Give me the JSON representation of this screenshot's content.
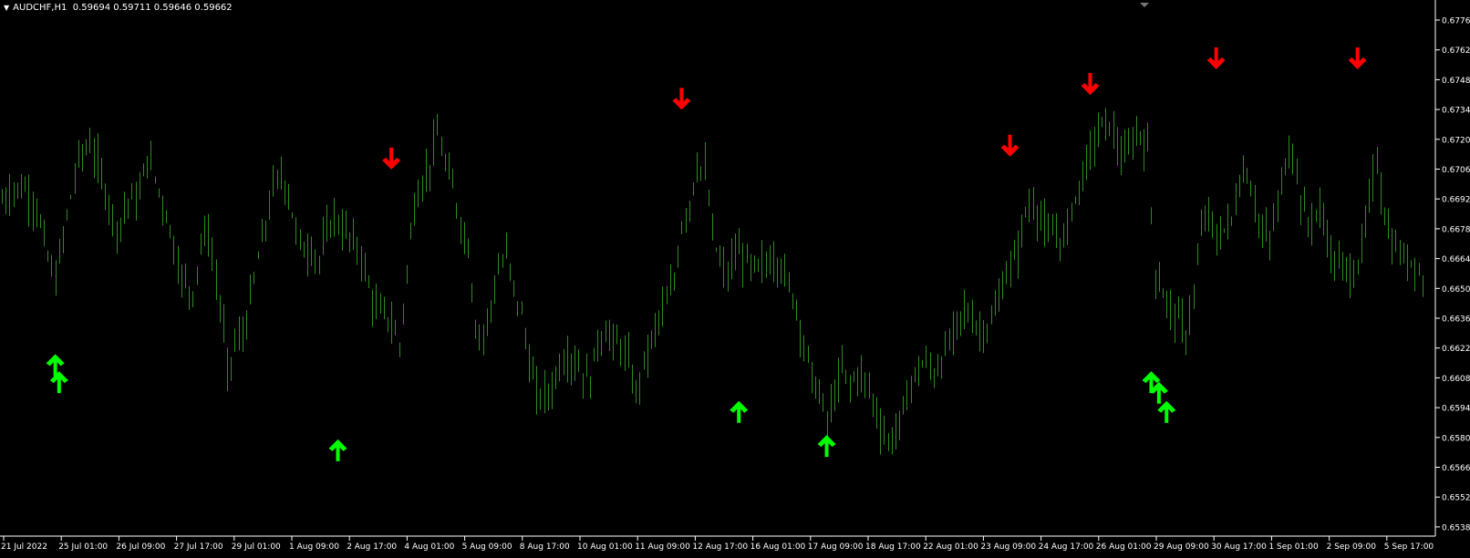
{
  "header": {
    "dropdown_icon": "triangle-down-icon",
    "symbol_timeframe": "AUDCHF,H1",
    "ohlc": "0.59694 0.59711 0.59646 0.59662"
  },
  "colors": {
    "background": "#000000",
    "bars": "#2f8a22",
    "axis": "#ffffff",
    "buy_arrow": "#00ff00",
    "sell_arrow": "#ff0000"
  },
  "chart_data": {
    "type": "ohlc-bars",
    "symbol": "AUDCHF",
    "timeframe": "H1",
    "grid": false,
    "ylim": [
      0.6531,
      0.6781
    ],
    "y_ticks": [
      "0.67760",
      "0.67620",
      "0.67480",
      "0.67340",
      "0.67200",
      "0.67060",
      "0.66920",
      "0.66780",
      "0.66640",
      "0.66500",
      "0.66360",
      "0.66220",
      "0.66080",
      "0.65940",
      "0.65800",
      "0.65660",
      "0.65520",
      "0.65380"
    ],
    "x_ticks": [
      "21 Jul 2022",
      "25 Jul 01:00",
      "26 Jul 09:00",
      "27 Jul 17:00",
      "29 Jul 01:00",
      "1 Aug 09:00",
      "2 Aug 17:00",
      "4 Aug 01:00",
      "5 Aug 09:00",
      "8 Aug 17:00",
      "10 Aug 01:00",
      "11 Aug 09:00",
      "12 Aug 17:00",
      "16 Aug 01:00",
      "17 Aug 09:00",
      "18 Aug 17:00",
      "22 Aug 01:00",
      "23 Aug 09:00",
      "24 Aug 17:00",
      "26 Aug 01:00",
      "29 Aug 09:00",
      "30 Aug 17:00",
      "1 Sep 01:00",
      "2 Sep 09:00",
      "5 Sep 17:00"
    ],
    "price_path": [
      [
        0,
        0.6691
      ],
      [
        3,
        0.6697
      ],
      [
        6,
        0.6697
      ],
      [
        9,
        0.6688
      ],
      [
        12,
        0.6664
      ],
      [
        14,
        0.6654
      ],
      [
        17,
        0.6684
      ],
      [
        20,
        0.6711
      ],
      [
        23,
        0.6718
      ],
      [
        25,
        0.6708
      ],
      [
        28,
        0.669
      ],
      [
        30,
        0.6678
      ],
      [
        33,
        0.6691
      ],
      [
        36,
        0.6694
      ],
      [
        38,
        0.6712
      ],
      [
        40,
        0.6702
      ],
      [
        43,
        0.6685
      ],
      [
        45,
        0.667
      ],
      [
        47,
        0.6655
      ],
      [
        50,
        0.6648
      ],
      [
        52,
        0.6672
      ],
      [
        54,
        0.6676
      ],
      [
        56,
        0.6654
      ],
      [
        58,
        0.663
      ],
      [
        59,
        0.661
      ],
      [
        61,
        0.6624
      ],
      [
        63,
        0.6628
      ],
      [
        65,
        0.6644
      ],
      [
        67,
        0.6664
      ],
      [
        69,
        0.668
      ],
      [
        71,
        0.6697
      ],
      [
        73,
        0.6703
      ],
      [
        75,
        0.6695
      ],
      [
        77,
        0.6676
      ],
      [
        79,
        0.6668
      ],
      [
        81,
        0.6669
      ],
      [
        83,
        0.6663
      ],
      [
        85,
        0.6676
      ],
      [
        87,
        0.6684
      ],
      [
        89,
        0.6678
      ],
      [
        91,
        0.6674
      ],
      [
        94,
        0.6666
      ],
      [
        96,
        0.6651
      ],
      [
        98,
        0.664
      ],
      [
        100,
        0.6638
      ],
      [
        102,
        0.6634
      ],
      [
        104,
        0.6623
      ],
      [
        106,
        0.6658
      ],
      [
        108,
        0.669
      ],
      [
        110,
        0.67
      ],
      [
        112,
        0.6708
      ],
      [
        114,
        0.6722
      ],
      [
        116,
        0.6708
      ],
      [
        118,
        0.6697
      ],
      [
        120,
        0.6681
      ],
      [
        122,
        0.667
      ],
      [
        124,
        0.6632
      ],
      [
        126,
        0.6628
      ],
      [
        128,
        0.6642
      ],
      [
        130,
        0.6658
      ],
      [
        132,
        0.6666
      ],
      [
        134,
        0.665
      ],
      [
        136,
        0.6638
      ],
      [
        138,
        0.6616
      ],
      [
        140,
        0.66
      ],
      [
        142,
        0.66
      ],
      [
        144,
        0.6603
      ],
      [
        146,
        0.6615
      ],
      [
        148,
        0.6618
      ],
      [
        150,
        0.6616
      ],
      [
        152,
        0.661
      ],
      [
        154,
        0.6607
      ],
      [
        156,
        0.6625
      ],
      [
        158,
        0.663
      ],
      [
        160,
        0.6625
      ],
      [
        162,
        0.6623
      ],
      [
        164,
        0.6615
      ],
      [
        166,
        0.66
      ],
      [
        168,
        0.6615
      ],
      [
        170,
        0.6625
      ],
      [
        172,
        0.6636
      ],
      [
        174,
        0.6643
      ],
      [
        176,
        0.6653
      ],
      [
        178,
        0.668
      ],
      [
        180,
        0.669
      ],
      [
        182,
        0.6708
      ],
      [
        184,
        0.6705
      ],
      [
        186,
        0.6675
      ],
      [
        188,
        0.6662
      ],
      [
        190,
        0.6656
      ],
      [
        192,
        0.6667
      ],
      [
        194,
        0.6665
      ],
      [
        196,
        0.666
      ],
      [
        198,
        0.6659
      ],
      [
        200,
        0.6662
      ],
      [
        202,
        0.6664
      ],
      [
        204,
        0.6661
      ],
      [
        206,
        0.6651
      ],
      [
        208,
        0.6642
      ],
      [
        210,
        0.6624
      ],
      [
        212,
        0.6609
      ],
      [
        214,
        0.66
      ],
      [
        216,
        0.6588
      ],
      [
        218,
        0.66
      ],
      [
        220,
        0.6612
      ],
      [
        222,
        0.6605
      ],
      [
        224,
        0.661
      ],
      [
        226,
        0.6607
      ],
      [
        228,
        0.6598
      ],
      [
        230,
        0.6586
      ],
      [
        232,
        0.6578
      ],
      [
        234,
        0.6582
      ],
      [
        236,
        0.6592
      ],
      [
        238,
        0.6606
      ],
      [
        240,
        0.6612
      ],
      [
        242,
        0.6615
      ],
      [
        244,
        0.661
      ],
      [
        246,
        0.6616
      ],
      [
        248,
        0.6624
      ],
      [
        250,
        0.6633
      ],
      [
        252,
        0.664
      ],
      [
        254,
        0.6636
      ],
      [
        256,
        0.663
      ],
      [
        258,
        0.6632
      ],
      [
        260,
        0.6638
      ],
      [
        262,
        0.6652
      ],
      [
        264,
        0.666
      ],
      [
        266,
        0.6668
      ],
      [
        268,
        0.6686
      ],
      [
        270,
        0.669
      ],
      [
        272,
        0.6683
      ],
      [
        274,
        0.6674
      ],
      [
        276,
        0.6676
      ],
      [
        278,
        0.6671
      ],
      [
        280,
        0.6688
      ],
      [
        282,
        0.6698
      ],
      [
        284,
        0.6708
      ],
      [
        286,
        0.672
      ],
      [
        288,
        0.6726
      ],
      [
        290,
        0.6728
      ],
      [
        292,
        0.6717
      ],
      [
        294,
        0.671
      ],
      [
        296,
        0.672
      ],
      [
        298,
        0.6723
      ],
      [
        300,
        0.6715
      ],
      [
        302,
        0.6658
      ],
      [
        304,
        0.6648
      ],
      [
        306,
        0.664
      ],
      [
        308,
        0.6636
      ],
      [
        310,
        0.6628
      ],
      [
        312,
        0.6648
      ],
      [
        314,
        0.6676
      ],
      [
        316,
        0.6686
      ],
      [
        318,
        0.6672
      ],
      [
        320,
        0.6678
      ],
      [
        322,
        0.6682
      ],
      [
        324,
        0.67
      ],
      [
        326,
        0.6705
      ],
      [
        328,
        0.669
      ],
      [
        330,
        0.6676
      ],
      [
        332,
        0.6673
      ],
      [
        334,
        0.6688
      ],
      [
        336,
        0.671
      ],
      [
        338,
        0.6716
      ],
      [
        340,
        0.6692
      ],
      [
        342,
        0.668
      ],
      [
        344,
        0.6686
      ],
      [
        346,
        0.6683
      ],
      [
        348,
        0.6666
      ],
      [
        350,
        0.666
      ],
      [
        352,
        0.666
      ],
      [
        354,
        0.6657
      ],
      [
        356,
        0.6668
      ],
      [
        358,
        0.6691
      ],
      [
        360,
        0.671
      ],
      [
        362,
        0.6685
      ],
      [
        364,
        0.667
      ],
      [
        366,
        0.6667
      ],
      [
        368,
        0.6662
      ],
      [
        370,
        0.6664
      ],
      [
        372,
        0.6652
      ]
    ],
    "signals": [
      {
        "type": "buy",
        "index": 14
      },
      {
        "type": "buy",
        "index": 15
      },
      {
        "type": "sell",
        "index": 102
      },
      {
        "type": "buy",
        "index": 88
      },
      {
        "type": "sell",
        "index": 178
      },
      {
        "type": "buy",
        "index": 193
      },
      {
        "type": "buy",
        "index": 216
      },
      {
        "type": "sell",
        "index": 264
      },
      {
        "type": "sell",
        "index": 285
      },
      {
        "type": "buy",
        "index": 301
      },
      {
        "type": "buy",
        "index": 303
      },
      {
        "type": "buy",
        "index": 305
      },
      {
        "type": "sell",
        "index": 318
      },
      {
        "type": "sell",
        "index": 355
      }
    ],
    "signal_prices": {
      "14": 0.6614,
      "15": 0.6606,
      "102": 0.6711,
      "88": 0.6574,
      "178": 0.6739,
      "193": 0.6592,
      "216": 0.6576,
      "264": 0.6717,
      "285": 0.6746,
      "301": 0.6606,
      "303": 0.6601,
      "305": 0.6592,
      "318": 0.6758,
      "355": 0.6758
    }
  }
}
